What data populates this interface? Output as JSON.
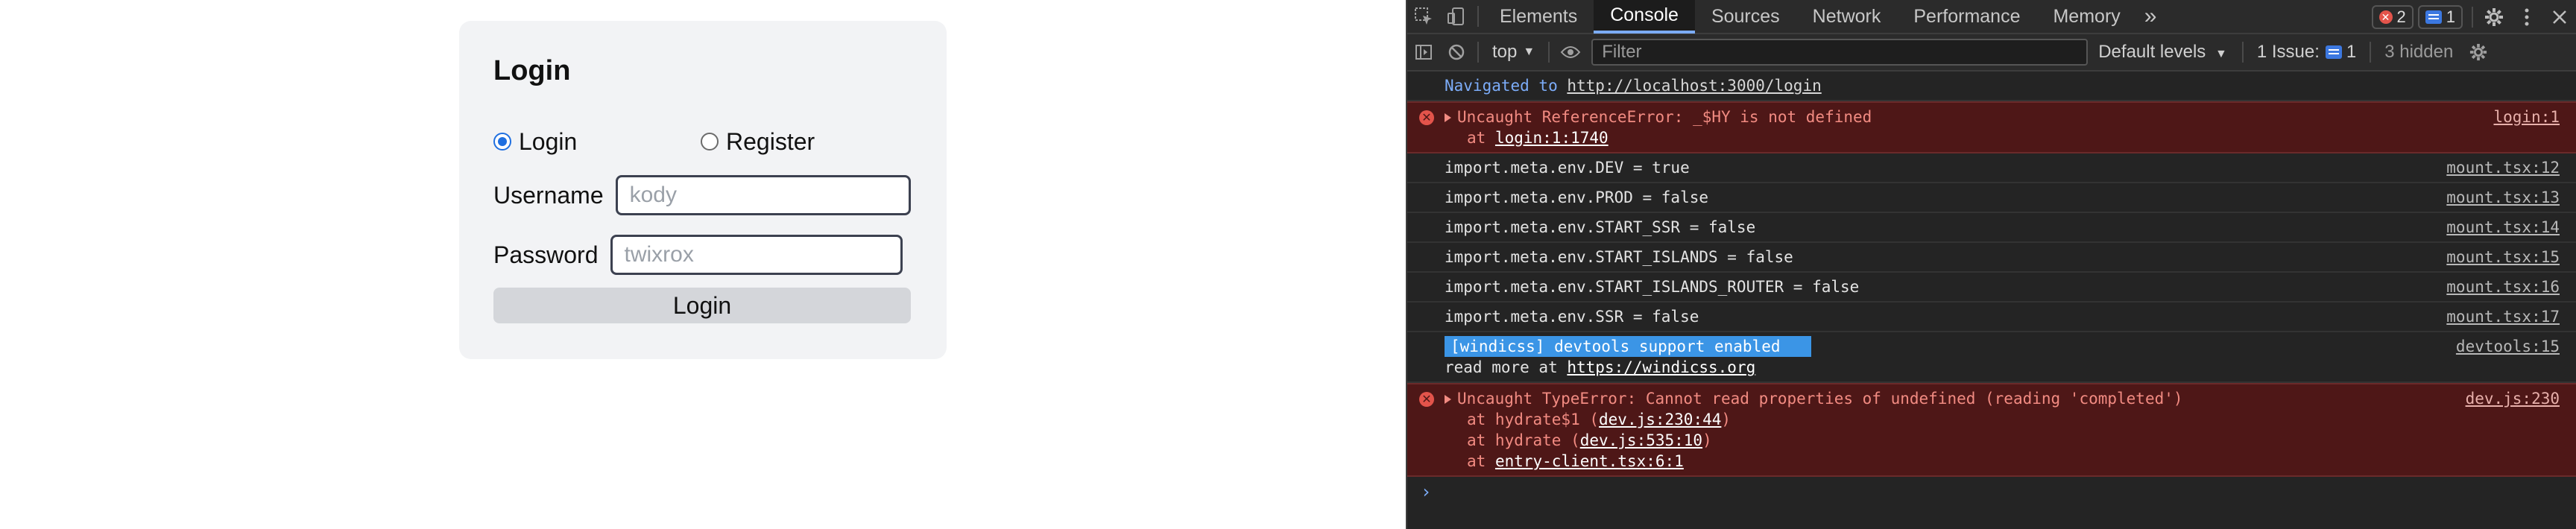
{
  "app": {
    "title": "Login",
    "radio_login": "Login",
    "radio_register": "Register",
    "selected_mode": "Login",
    "username_label": "Username",
    "username_placeholder": "kody",
    "password_label": "Password",
    "password_placeholder": "twixrox",
    "submit_label": "Login"
  },
  "devtools": {
    "tabs": [
      "Elements",
      "Console",
      "Sources",
      "Network",
      "Performance",
      "Memory"
    ],
    "active_tab": "Console",
    "more_tabs_icon": "»",
    "error_count": "2",
    "message_count": "1",
    "context": "top",
    "filter_placeholder": "Filter",
    "levels": "Default levels",
    "issues_label": "1 Issue:",
    "issues_count": "1",
    "hidden": "3 hidden",
    "console": {
      "nav_prefix": "Navigated to",
      "nav_url": "http://localhost:3000/login",
      "err1_text": "Uncaught ReferenceError: _$HY is not defined",
      "err1_stack_prefix": "at",
      "err1_stack_link": "login:1:1740",
      "err1_src": "login:1",
      "logs": [
        {
          "text": "import.meta.env.DEV = true",
          "src": "mount.tsx:12"
        },
        {
          "text": "import.meta.env.PROD = false",
          "src": "mount.tsx:13"
        },
        {
          "text": "import.meta.env.START_SSR = false",
          "src": "mount.tsx:14"
        },
        {
          "text": "import.meta.env.START_ISLANDS = false",
          "src": "mount.tsx:15"
        },
        {
          "text": "import.meta.env.START_ISLANDS_ROUTER = false",
          "src": "mount.tsx:16"
        },
        {
          "text": "import.meta.env.SSR = false",
          "src": "mount.tsx:17"
        }
      ],
      "windicss_badge": "[windicss] devtools support enabled",
      "windicss_readmore": "read more at",
      "windicss_url": "https://windicss.org",
      "windicss_src": "devtools:15",
      "err2_text": "Uncaught TypeError: Cannot read properties of undefined (reading 'completed')",
      "err2_src": "dev.js:230",
      "err2_stack": [
        {
          "prefix": "at hydrate$1 (",
          "link": "dev.js:230:44",
          "suffix": ")"
        },
        {
          "prefix": "at hydrate (",
          "link": "dev.js:535:10",
          "suffix": ")"
        },
        {
          "prefix": "at",
          "link": "entry-client.tsx:6:1",
          "suffix": ""
        }
      ],
      "prompt": "›"
    }
  }
}
